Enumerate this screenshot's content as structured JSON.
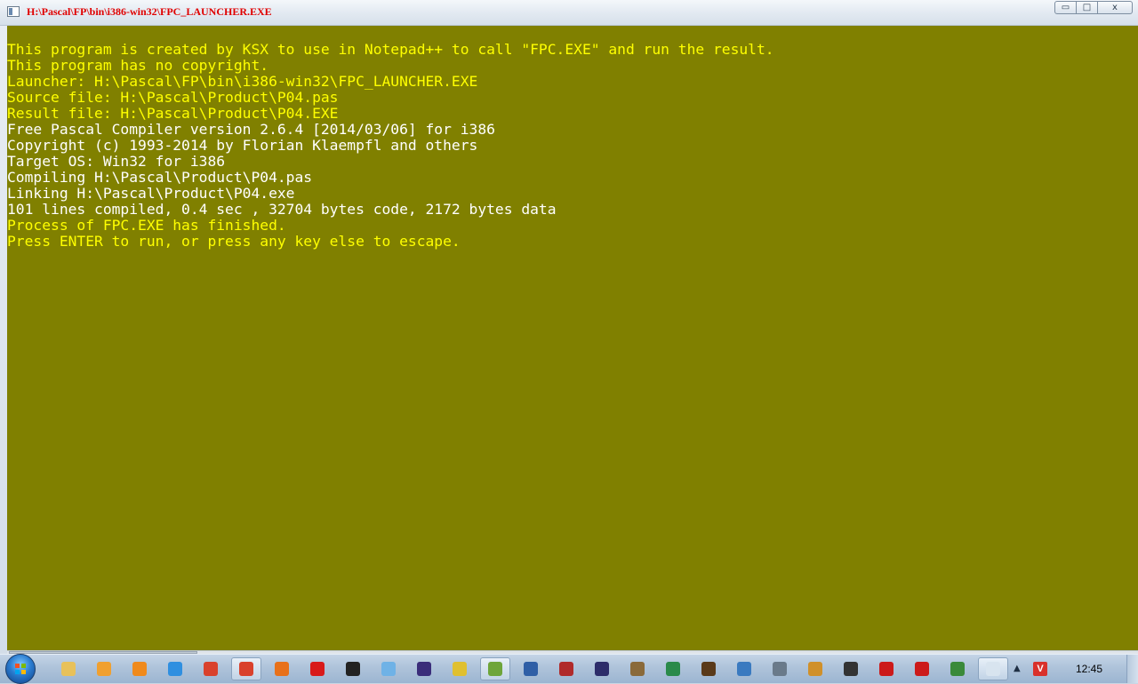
{
  "window": {
    "title": "H:\\Pascal\\FP\\bin\\i386-win32\\FPC_LAUNCHER.EXE",
    "controls": {
      "minimize": "▭",
      "maximize": "□",
      "close": "x"
    }
  },
  "console": {
    "background": "#808000",
    "lines": [
      {
        "text": "This program is created by KSX to use in Notepad++ to call \"FPC.EXE\" and run the result.",
        "color": "#ffff00"
      },
      {
        "text": "This program has no copyright.",
        "color": "#ffff00"
      },
      {
        "text": "Launcher: H:\\Pascal\\FP\\bin\\i386-win32\\FPC_LAUNCHER.EXE",
        "color": "#ffff00"
      },
      {
        "text": "Source file: H:\\Pascal\\Product\\P04.pas",
        "color": "#ffff00"
      },
      {
        "text": "Result file: H:\\Pascal\\Product\\P04.EXE",
        "color": "#ffff00"
      },
      {
        "text": "Free Pascal Compiler version 2.6.4 [2014/03/06] for i386",
        "color": "#ffffff"
      },
      {
        "text": "Copyright (c) 1993-2014 by Florian Klaempfl and others",
        "color": "#ffffff"
      },
      {
        "text": "Target OS: Win32 for i386",
        "color": "#ffffff"
      },
      {
        "text": "Compiling H:\\Pascal\\Product\\P04.pas",
        "color": "#ffffff"
      },
      {
        "text": "Linking H:\\Pascal\\Product\\P04.exe",
        "color": "#ffffff"
      },
      {
        "text": "101 lines compiled, 0.4 sec , 32704 bytes code, 2172 bytes data",
        "color": "#ffffff"
      },
      {
        "text": "Process of FPC.EXE has finished.",
        "color": "#ffff00"
      },
      {
        "text": "Press ENTER to run, or press any key else to escape.",
        "color": "#ffff00"
      }
    ]
  },
  "taskbar": {
    "start_icon": "windows-logo-icon",
    "items": [
      {
        "name": "file-explorer-icon",
        "color": "#e8c15a"
      },
      {
        "name": "grid-app-icon",
        "color": "#f0a030"
      },
      {
        "name": "media-player-icon",
        "color": "#f08a1c"
      },
      {
        "name": "internet-explorer-icon",
        "color": "#2f8fe0"
      },
      {
        "name": "chrome-icon",
        "color": "#d9412c"
      },
      {
        "name": "chrome-active-icon",
        "color": "#d9412c",
        "active": true
      },
      {
        "name": "firefox-icon",
        "color": "#e8711a"
      },
      {
        "name": "opera-icon",
        "color": "#d81a1a"
      },
      {
        "name": "command-prompt-icon",
        "color": "#222222"
      },
      {
        "name": "paint-icon",
        "color": "#6fb2e6"
      },
      {
        "name": "eclipse-icon",
        "color": "#3a2d7a"
      },
      {
        "name": "clock-app-icon",
        "color": "#e0c030"
      },
      {
        "name": "notepad-icon",
        "color": "#6ea53a",
        "active": true
      },
      {
        "name": "calculator-icon",
        "color": "#2f5fa6"
      },
      {
        "name": "game-icon",
        "color": "#b02a2a"
      },
      {
        "name": "eclipse-ide-icon",
        "color": "#2d2d6a"
      },
      {
        "name": "editor-icon",
        "color": "#8a6a3a"
      },
      {
        "name": "globe-icon",
        "color": "#2a8a4a"
      },
      {
        "name": "castle-icon",
        "color": "#5a3a1a"
      },
      {
        "name": "bone-app-icon",
        "color": "#3a7ac0"
      },
      {
        "name": "settings-icon",
        "color": "#6a7a8a"
      },
      {
        "name": "puzzle-icon",
        "color": "#d0902a"
      },
      {
        "name": "chess-icon",
        "color": "#333333"
      },
      {
        "name": "flash-icon",
        "color": "#cc1a1a"
      },
      {
        "name": "flash-alt-icon",
        "color": "#cc1a1a"
      },
      {
        "name": "network-icon",
        "color": "#3a8a3a"
      },
      {
        "name": "console-window-icon",
        "color": "#d8e4ef",
        "active": true
      }
    ],
    "tray": {
      "arrow": "▲",
      "v_icon": "V",
      "time": "12:45"
    }
  }
}
